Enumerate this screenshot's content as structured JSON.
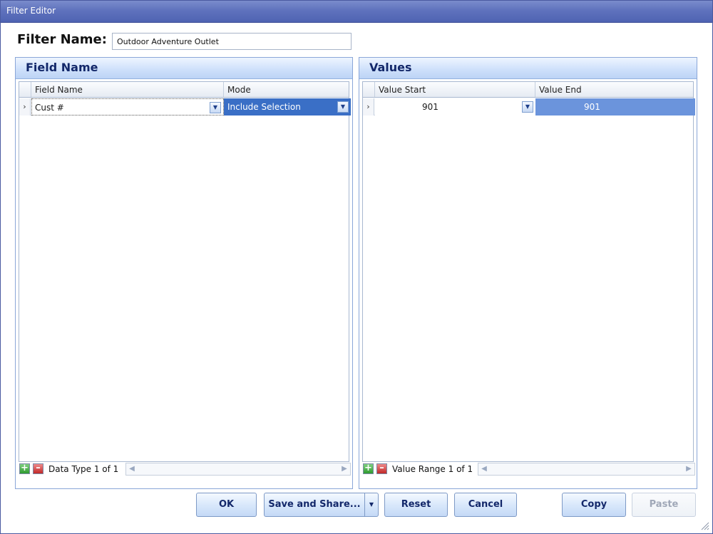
{
  "window": {
    "title": "Filter Editor"
  },
  "filter": {
    "label": "Filter Name:",
    "value": "Outdoor Adventure Outlet"
  },
  "field_panel": {
    "title": "Field Name",
    "columns": [
      "Field Name",
      "Mode"
    ],
    "rows": [
      {
        "field": "Cust #",
        "mode": "Include Selection"
      }
    ],
    "navigator": "Data Type 1 of 1"
  },
  "values_panel": {
    "title": "Values",
    "columns": [
      "Value Start",
      "Value End"
    ],
    "rows": [
      {
        "start": "901",
        "end": "901"
      }
    ],
    "navigator": "Value Range 1 of 1"
  },
  "buttons": {
    "ok": "OK",
    "save_share": "Save and Share...",
    "reset": "Reset",
    "cancel": "Cancel",
    "copy": "Copy",
    "paste": "Paste"
  },
  "icons": {
    "row_indicator": "chevron-right-icon",
    "dropdown": "chevron-down-icon",
    "add": "plus-icon",
    "remove": "minus-icon",
    "scroll_left": "arrow-left-icon",
    "scroll_right": "arrow-right-icon"
  },
  "colors": {
    "selection": "#3a6fc6",
    "selection_light": "#6b94dc",
    "title_bar": "#5f72bd",
    "panel_title": "#13286a"
  }
}
